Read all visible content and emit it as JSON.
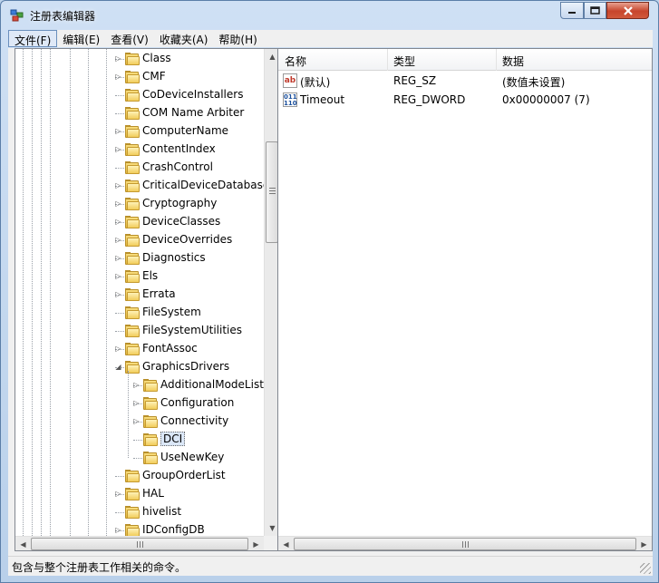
{
  "window": {
    "title": "注册表编辑器"
  },
  "menu": [
    {
      "label": "文件(F)",
      "active": true
    },
    {
      "label": "编辑(E)",
      "active": false
    },
    {
      "label": "查看(V)",
      "active": false
    },
    {
      "label": "收藏夹(A)",
      "active": false
    },
    {
      "label": "帮助(H)",
      "active": false
    }
  ],
  "tree": {
    "items": [
      {
        "label": "Class",
        "level": 0,
        "expander": "collapsed"
      },
      {
        "label": "CMF",
        "level": 0,
        "expander": "collapsed"
      },
      {
        "label": "CoDeviceInstallers",
        "level": 0,
        "expander": "none"
      },
      {
        "label": "COM Name Arbiter",
        "level": 0,
        "expander": "none"
      },
      {
        "label": "ComputerName",
        "level": 0,
        "expander": "collapsed"
      },
      {
        "label": "ContentIndex",
        "level": 0,
        "expander": "collapsed"
      },
      {
        "label": "CrashControl",
        "level": 0,
        "expander": "none"
      },
      {
        "label": "CriticalDeviceDatabase",
        "level": 0,
        "expander": "collapsed"
      },
      {
        "label": "Cryptography",
        "level": 0,
        "expander": "collapsed"
      },
      {
        "label": "DeviceClasses",
        "level": 0,
        "expander": "collapsed"
      },
      {
        "label": "DeviceOverrides",
        "level": 0,
        "expander": "collapsed"
      },
      {
        "label": "Diagnostics",
        "level": 0,
        "expander": "collapsed"
      },
      {
        "label": "Els",
        "level": 0,
        "expander": "collapsed"
      },
      {
        "label": "Errata",
        "level": 0,
        "expander": "collapsed"
      },
      {
        "label": "FileSystem",
        "level": 0,
        "expander": "none"
      },
      {
        "label": "FileSystemUtilities",
        "level": 0,
        "expander": "none"
      },
      {
        "label": "FontAssoc",
        "level": 0,
        "expander": "collapsed"
      },
      {
        "label": "GraphicsDrivers",
        "level": 0,
        "expander": "expanded"
      },
      {
        "label": "AdditionalModeLists",
        "level": 1,
        "expander": "collapsed"
      },
      {
        "label": "Configuration",
        "level": 1,
        "expander": "collapsed"
      },
      {
        "label": "Connectivity",
        "level": 1,
        "expander": "collapsed"
      },
      {
        "label": "DCI",
        "level": 1,
        "expander": "none",
        "selected": true
      },
      {
        "label": "UseNewKey",
        "level": 1,
        "expander": "none"
      },
      {
        "label": "GroupOrderList",
        "level": 0,
        "expander": "none"
      },
      {
        "label": "HAL",
        "level": 0,
        "expander": "collapsed"
      },
      {
        "label": "hivelist",
        "level": 0,
        "expander": "none"
      },
      {
        "label": "IDConfigDB",
        "level": 0,
        "expander": "collapsed"
      }
    ]
  },
  "list": {
    "columns": [
      "名称",
      "类型",
      "数据"
    ],
    "rows": [
      {
        "icon": "string-value-icon",
        "icon_text": "ab",
        "name": "(默认)",
        "type": "REG_SZ",
        "data": "(数值未设置)"
      },
      {
        "icon": "binary-value-icon",
        "icon_text": "011 110",
        "name": "Timeout",
        "type": "REG_DWORD",
        "data": "0x00000007 (7)"
      }
    ]
  },
  "status": {
    "text": "包含与整个注册表工作相关的命令。"
  },
  "colors": {
    "selection": "#dbe7f7",
    "folder": "#f1cd5b",
    "titlebar": "#cfe0f4"
  }
}
